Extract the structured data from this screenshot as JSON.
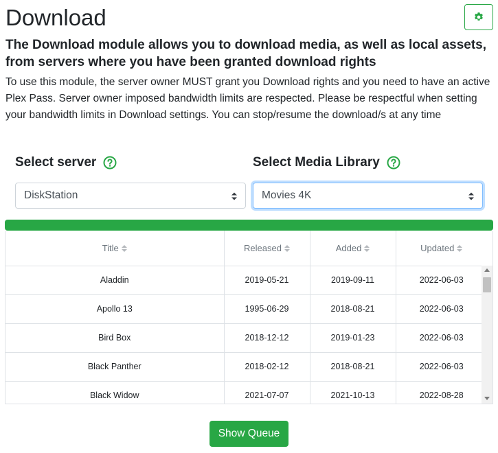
{
  "page": {
    "title": "Download",
    "subtitle": "The Download module allows you to download media, as well as local assets, from servers where you have been granted download rights",
    "description": "To use this module, the server owner MUST grant you Download rights and you need to have an active Plex Pass. Server owner imposed bandwidth limits are respected. Please be respectful when setting your bandwidth limits in Download settings. You can stop/resume the download/s at any time"
  },
  "header": {
    "settings_icon": "gear-icon"
  },
  "server_select": {
    "label": "Select server",
    "value": "DiskStation",
    "help_icon": "question-circle-icon"
  },
  "library_select": {
    "label": "Select Media Library",
    "value": "Movies 4K",
    "help_icon": "question-circle-icon"
  },
  "progress": {
    "fraction": 1.0,
    "color": "#28a745"
  },
  "table": {
    "columns": [
      "Title",
      "Released",
      "Added",
      "Updated"
    ],
    "rows": [
      [
        "Aladdin",
        "2019-05-21",
        "2019-09-11",
        "2022-06-03"
      ],
      [
        "Apollo 13",
        "1995-06-29",
        "2018-08-21",
        "2022-06-03"
      ],
      [
        "Bird Box",
        "2018-12-12",
        "2019-01-23",
        "2022-06-03"
      ],
      [
        "Black Panther",
        "2018-02-12",
        "2018-08-21",
        "2022-06-03"
      ],
      [
        "Black Widow",
        "2021-07-07",
        "2021-10-13",
        "2022-08-28"
      ]
    ]
  },
  "actions": {
    "show_queue_label": "Show Queue"
  },
  "colors": {
    "accent": "#28a745",
    "focus_border": "#80bdff"
  }
}
